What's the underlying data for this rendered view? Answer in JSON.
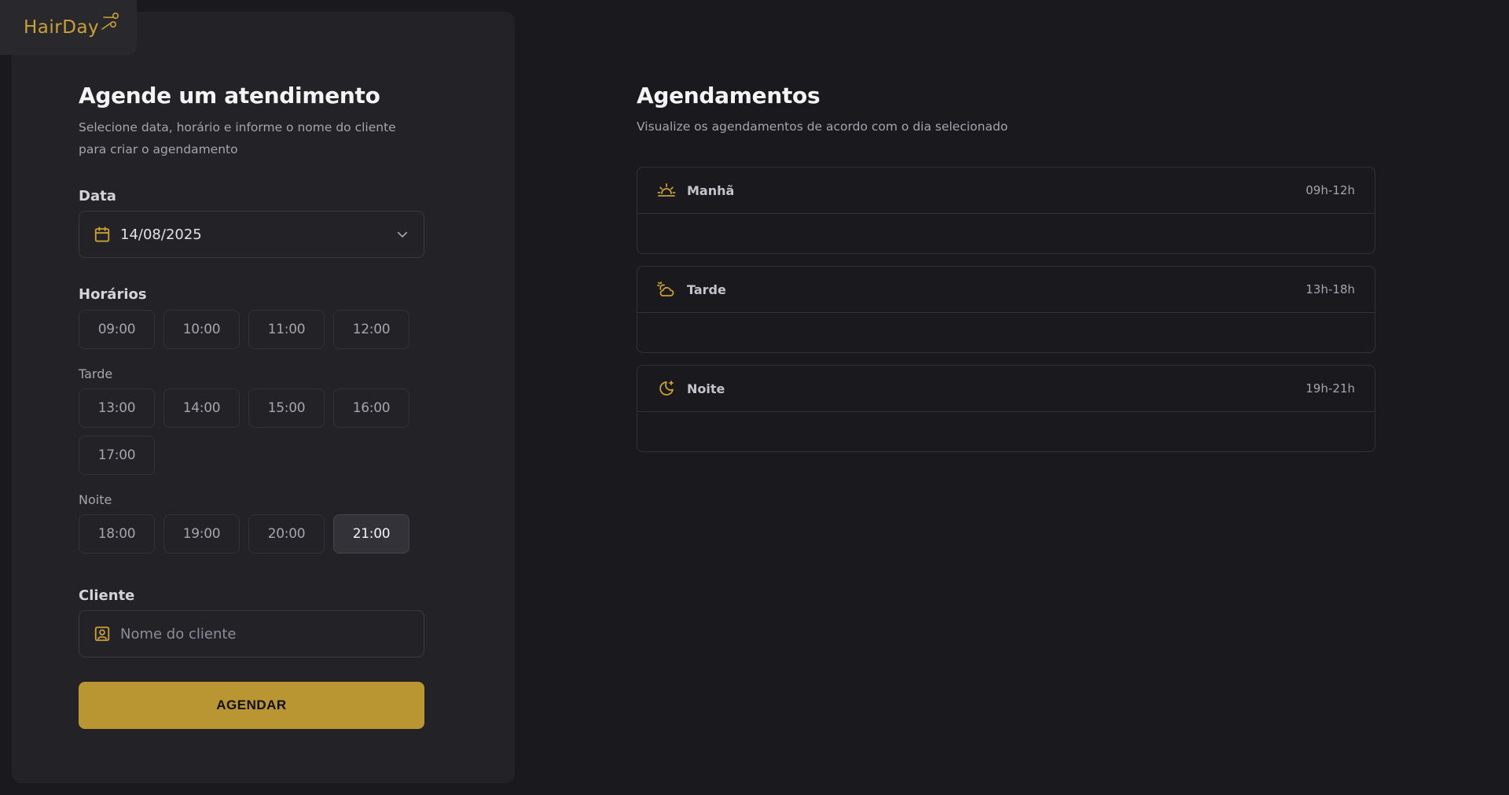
{
  "app": {
    "logo_text": "HairDay",
    "accent": "#b99632"
  },
  "form": {
    "title": "Agende um atendimento",
    "subtitle": "Selecione data, horário e informe o nome do cliente para criar o agendamento",
    "date": {
      "label": "Data",
      "value": "14/08/2025",
      "icon": "calendar-icon",
      "dropdown_icon": "chevron-down-icon"
    },
    "horarios": {
      "label": "Horários",
      "manha": [
        "09:00",
        "10:00",
        "11:00",
        "12:00"
      ],
      "tarde_label": "Tarde",
      "tarde": [
        "13:00",
        "14:00",
        "15:00",
        "16:00",
        "17:00"
      ],
      "noite_label": "Noite",
      "noite": [
        "18:00",
        "19:00",
        "20:00",
        "21:00"
      ],
      "selected": "21:00"
    },
    "cliente": {
      "label": "Cliente",
      "placeholder": "Nome do cliente",
      "icon": "user-square-icon"
    },
    "submit_label": "AGENDAR"
  },
  "schedule": {
    "title": "Agendamentos",
    "description": "Visualize os agendamentos de acordo com o dia selecionado",
    "periods": [
      {
        "name": "Manhã",
        "range": "09h-12h",
        "icon": "sunrise-icon"
      },
      {
        "name": "Tarde",
        "range": "13h-18h",
        "icon": "cloud-sun-icon"
      },
      {
        "name": "Noite",
        "range": "19h-21h",
        "icon": "moon-star-icon"
      }
    ]
  }
}
